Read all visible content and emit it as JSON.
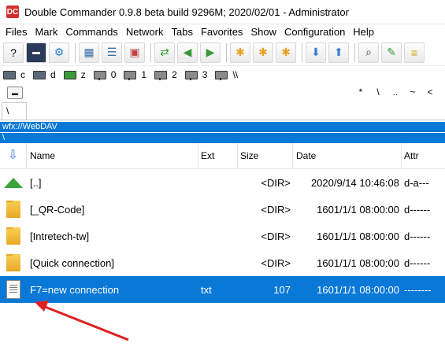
{
  "window": {
    "title": "Double Commander 0.9.8 beta build 9296M; 2020/02/01 - Administrator",
    "icon": "DC"
  },
  "menu": [
    "Files",
    "Mark",
    "Commands",
    "Network",
    "Tabs",
    "Favorites",
    "Show",
    "Configuration",
    "Help"
  ],
  "toolbar_icons": [
    "help-icon",
    "terminal-icon",
    "settings-icon",
    "brief-view-icon",
    "full-view-icon",
    "thumbnail-view-icon",
    "copy-paths-icon",
    "swap-left-icon",
    "swap-right-icon",
    "mark-plus-icon",
    "mark-minus-icon",
    "mark-invert-icon",
    "pack-icon",
    "unpack-icon",
    "search-icon",
    "edit-icon",
    "compare-icon"
  ],
  "drives": [
    {
      "label": "c",
      "icon": "hard-drive-icon"
    },
    {
      "label": "d",
      "icon": "hard-drive-icon"
    },
    {
      "label": "z",
      "icon": "hard-drive-icon"
    },
    {
      "label": "0",
      "icon": "network-drive-icon"
    },
    {
      "label": "1",
      "icon": "network-drive-icon"
    },
    {
      "label": "2",
      "icon": "network-drive-icon"
    },
    {
      "label": "3",
      "icon": "network-drive-icon"
    },
    {
      "label": "\\\\",
      "icon": "network-drive-icon"
    }
  ],
  "quick_buttons": [
    "*",
    "\\",
    "..",
    "~",
    "<"
  ],
  "tab": {
    "label": "\\"
  },
  "path": "wfx://WebDAV",
  "current_dir": "\\",
  "columns": {
    "name": "Name",
    "ext": "Ext",
    "size": "Size",
    "date": "Date",
    "attr": "Attr"
  },
  "rows": [
    {
      "name": "[..]",
      "ext": "",
      "size": "<DIR>",
      "date": "2020/9/14 10:46:08",
      "attr": "d-a---",
      "icon": "parent-dir-icon"
    },
    {
      "name": "[_QR-Code]",
      "ext": "",
      "size": "<DIR>",
      "date": "1601/1/1 08:00:00",
      "attr": "d------",
      "icon": "folder-icon"
    },
    {
      "name": "[Intretech-tw]",
      "ext": "",
      "size": "<DIR>",
      "date": "1601/1/1 08:00:00",
      "attr": "d------",
      "icon": "folder-icon"
    },
    {
      "name": "[Quick connection]",
      "ext": "",
      "size": "<DIR>",
      "date": "1601/1/1 08:00:00",
      "attr": "d------",
      "icon": "folder-icon"
    },
    {
      "name": "F7=new connection",
      "ext": "txt",
      "size": "107",
      "date": "1601/1/1 08:00:00",
      "attr": "--------",
      "icon": "text-file-icon"
    }
  ],
  "selected_row": 4,
  "colors": {
    "selection": "#0a78d7",
    "annotation_arrow": "#e02020"
  }
}
